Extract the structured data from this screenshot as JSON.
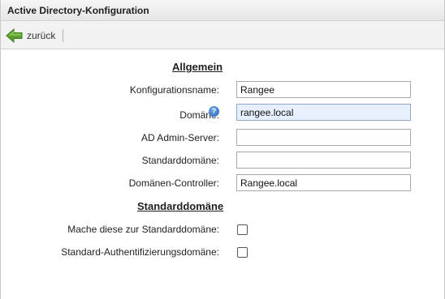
{
  "window": {
    "title": "Active Directory-Konfiguration"
  },
  "toolbar": {
    "back_label": "zurück",
    "back_icon": "green-left-arrow-icon"
  },
  "sections": {
    "general": "Allgemein",
    "default_domain": "Standarddomäne"
  },
  "fields": {
    "config_name": {
      "label": "Konfigurationsname:",
      "value": "Rangee"
    },
    "domain": {
      "label": "Domäne:",
      "value": "rangee.local"
    },
    "ad_admin_server": {
      "label": "AD Admin-Server:",
      "value": ""
    },
    "default_domain": {
      "label": "Standarddomäne:",
      "value": ""
    },
    "domain_controller": {
      "label": "Domänen-Controller:",
      "value": "Rangee.local"
    }
  },
  "checkboxes": {
    "make_default": {
      "label": "Mache diese zur Standarddomäne:",
      "checked": false
    },
    "auth_domain": {
      "label": "Standard-Authentifizierungsdomäne:",
      "checked": false
    }
  },
  "help": {
    "glyph": "?"
  },
  "colors": {
    "accent_green": "#5aa02c",
    "focus_bg": "#e8f0fe",
    "help_blue": "#2563b7"
  }
}
